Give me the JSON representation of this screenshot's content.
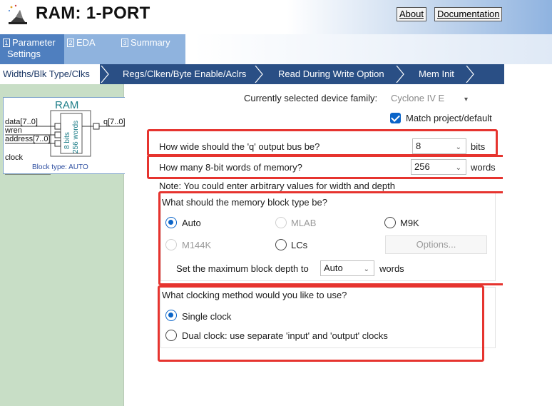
{
  "header": {
    "title": "RAM: 1-PORT",
    "about_label": "About",
    "documentation_label": "Documentation"
  },
  "tabs": [
    {
      "num": "1",
      "label_line1": "Parameter",
      "label_line2": "Settings"
    },
    {
      "num": "2",
      "label_line1": "EDA"
    },
    {
      "num": "3",
      "label_line1": "Summary"
    }
  ],
  "breadcrumbs": [
    "Widths/Blk Type/Clks",
    "Regs/Clken/Byte Enable/Aclrs",
    "Read During Write Option",
    "Mem Init"
  ],
  "symbol": {
    "title": "RAM",
    "ports_in": [
      "data[7..0]",
      "wren",
      "address[7..0]",
      "clock"
    ],
    "port_out": "q[7..0]",
    "vertical_text_1": "8 bits",
    "vertical_text_2": "256 words",
    "block_type": "Block type: AUTO"
  },
  "device": {
    "label": "Currently selected device family:",
    "value": "Cyclone IV E",
    "match_label": "Match project/default"
  },
  "width": {
    "question": "How wide should the 'q' output bus be?",
    "value": "8",
    "unit": "bits"
  },
  "depth": {
    "question": "How many 8-bit words of memory?",
    "value": "256",
    "unit": "words"
  },
  "note": "Note: You could enter arbitrary values for width and depth",
  "block_type": {
    "question": "What should the memory block type be?",
    "options": [
      "Auto",
      "MLAB",
      "M9K",
      "M144K",
      "LCs"
    ],
    "options_button": "Options...",
    "max_depth_label": "Set the maximum block depth to",
    "max_depth_value": "Auto",
    "max_depth_unit": "words"
  },
  "clocking": {
    "question": "What clocking method would you like to use?",
    "options": [
      "Single clock",
      "Dual clock: use separate 'input' and 'output' clocks"
    ]
  },
  "colors": {
    "accent": "#0a64c8",
    "highlight": "#e6342f",
    "breadcrumb_bg": "#2a4f85",
    "left_pane_bg": "#c8dec6"
  }
}
